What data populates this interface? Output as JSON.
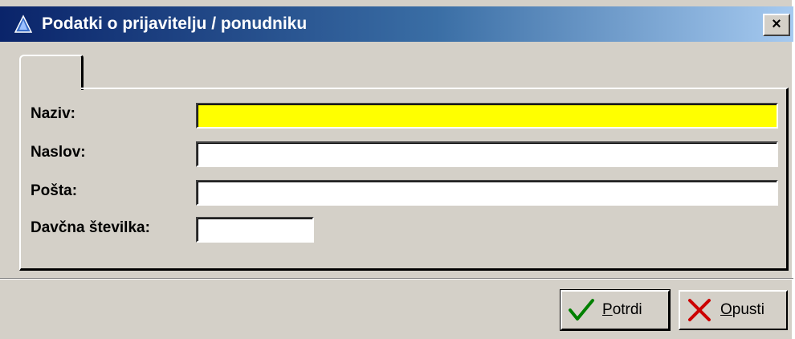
{
  "window": {
    "title": "Podatki o prijavitelju / ponudniku",
    "close_label": "×"
  },
  "tab": {
    "label": ""
  },
  "form": {
    "naziv": {
      "label": "Naziv:",
      "value": "",
      "placeholder": "",
      "background": "#ffff00"
    },
    "naslov": {
      "label": "Naslov:",
      "value": "",
      "placeholder": ""
    },
    "posta": {
      "label": "Pošta:",
      "value": "",
      "placeholder": ""
    },
    "davcna": {
      "label": "Davčna številka:",
      "value": "",
      "placeholder": ""
    }
  },
  "buttons": {
    "ok": {
      "mnemonic": "P",
      "rest": "otrdi",
      "icon": "check-icon",
      "icon_color": "#008000"
    },
    "cancel": {
      "mnemonic": "O",
      "rest": "pusti",
      "icon": "x-icon",
      "icon_color": "#cc0000"
    }
  },
  "colors": {
    "face": "#d4d0c8",
    "title_start": "#0a246a",
    "title_end": "#a6caf0",
    "required_field": "#ffff00"
  }
}
